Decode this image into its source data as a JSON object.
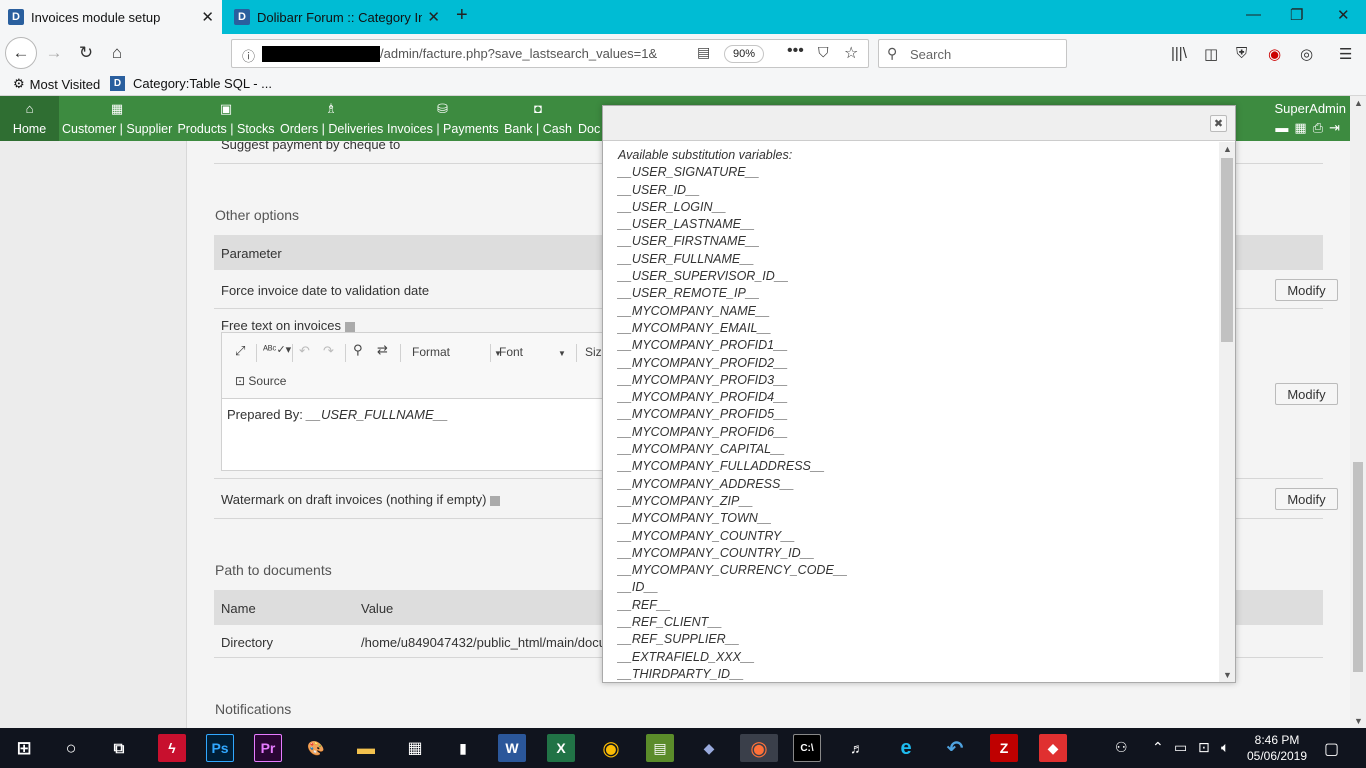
{
  "browser": {
    "tabs": [
      {
        "title": "Invoices module setup",
        "active": true
      },
      {
        "title": "Dolibarr Forum :: Category Inde",
        "active": false
      }
    ],
    "new_tab": "+",
    "favicon_letter": "D",
    "url_text": "/admin/facture.php?save_lastsearch_values=1&",
    "zoom": "90%",
    "search_placeholder": "Search",
    "bookmarks": [
      "Most Visited",
      "Category:Table SQL - ..."
    ]
  },
  "menu": {
    "items": [
      "Home",
      "Customer | Supplier",
      "Products | Stocks",
      "Orders | Deliveries",
      "Invoices | Payments",
      "Bank | Cash",
      "Doc"
    ],
    "user": "SuperAdmin"
  },
  "page": {
    "suggest_cheque": "Suggest payment by cheque to",
    "other_options_title": "Other options",
    "parameter_header": "Parameter",
    "force_invoice_date": "Force invoice date to validation date",
    "free_text_label": "Free text on invoices",
    "watermark_label": "Watermark on draft invoices (nothing if empty)",
    "modify_label": "Modify",
    "editor": {
      "format": "Format",
      "font": "Font",
      "size": "Size",
      "source": "Source",
      "content_prefix": "Prepared By: ",
      "content_var": "__USER_FULLNAME__"
    },
    "path_title": "Path to documents",
    "name_header": "Name",
    "value_header": "Value",
    "directory_label": "Directory",
    "directory_value": "/home/u849047432/public_html/main/docu",
    "notifications_title": "Notifications"
  },
  "modal": {
    "title": "Available substitution variables:",
    "variables": [
      "__USER_SIGNATURE__",
      "__USER_ID__",
      "__USER_LOGIN__",
      "__USER_LASTNAME__",
      "__USER_FIRSTNAME__",
      "__USER_FULLNAME__",
      "__USER_SUPERVISOR_ID__",
      "__USER_REMOTE_IP__",
      "__MYCOMPANY_NAME__",
      "__MYCOMPANY_EMAIL__",
      "__MYCOMPANY_PROFID1__",
      "__MYCOMPANY_PROFID2__",
      "__MYCOMPANY_PROFID3__",
      "__MYCOMPANY_PROFID4__",
      "__MYCOMPANY_PROFID5__",
      "__MYCOMPANY_PROFID6__",
      "__MYCOMPANY_CAPITAL__",
      "__MYCOMPANY_FULLADDRESS__",
      "__MYCOMPANY_ADDRESS__",
      "__MYCOMPANY_ZIP__",
      "__MYCOMPANY_TOWN__",
      "__MYCOMPANY_COUNTRY__",
      "__MYCOMPANY_COUNTRY_ID__",
      "__MYCOMPANY_CURRENCY_CODE__",
      "__ID__",
      "__REF__",
      "__REF_CLIENT__",
      "__REF_SUPPLIER__",
      "__EXTRAFIELD_XXX__",
      "__THIRDPARTY_ID__"
    ]
  },
  "taskbar": {
    "time": "8:46 PM",
    "date": "05/06/2019"
  },
  "colors": {
    "tabbar": "#00bcd4",
    "menu": "#3d8b40",
    "taskbar": "#10141e"
  }
}
